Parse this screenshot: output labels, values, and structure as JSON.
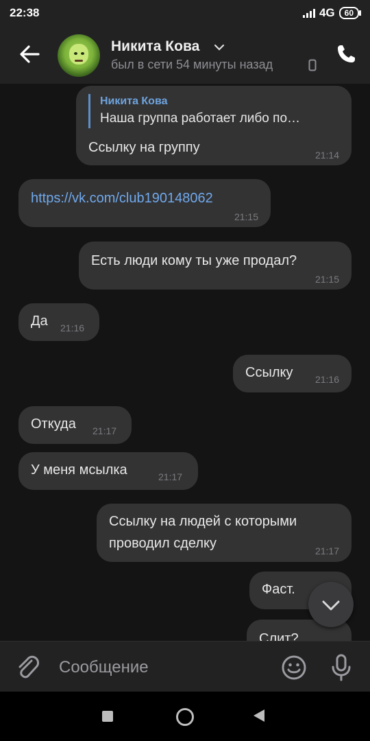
{
  "status_bar": {
    "time": "22:38",
    "network": "4G",
    "battery": "60"
  },
  "header": {
    "back_icon": "arrow-left-icon",
    "contact_name": "Никита Кова",
    "contact_status": "был в сети 54 минуты назад",
    "call_icon": "phone-icon"
  },
  "messages": [
    {
      "side": "out",
      "quote_name": "Никита Кова",
      "quote_text": "Наша группа работает либо по…",
      "text": "Ссылку на группу",
      "time": "21:14"
    },
    {
      "side": "in",
      "text": "https://vk.com/club190148062",
      "time": "21:15",
      "is_link": true
    },
    {
      "side": "out",
      "text": "Есть люди кому ты уже продал?",
      "time": "21:15"
    },
    {
      "side": "in",
      "text": "Да",
      "time": "21:16"
    },
    {
      "side": "out",
      "text": "Ссылку",
      "time": "21:16"
    },
    {
      "side": "in",
      "text": "Откуда",
      "time": "21:17"
    },
    {
      "side": "in",
      "text": "У меня мсылка",
      "time": "21:17"
    },
    {
      "side": "out",
      "text_line1": "Ссылку на людей с которыми",
      "text_line2": "проводил сделку",
      "time": "21:17"
    },
    {
      "side": "out",
      "text": "Фаст.",
      "time": ""
    },
    {
      "side": "out",
      "text": "Слит?",
      "time": ""
    }
  ],
  "composer": {
    "placeholder": "Сообщение"
  },
  "colors": {
    "background": "#141414",
    "bubble": "#333334",
    "bar": "#222223",
    "link": "#70a9ec",
    "quote_accent": "#6ea3dd"
  }
}
